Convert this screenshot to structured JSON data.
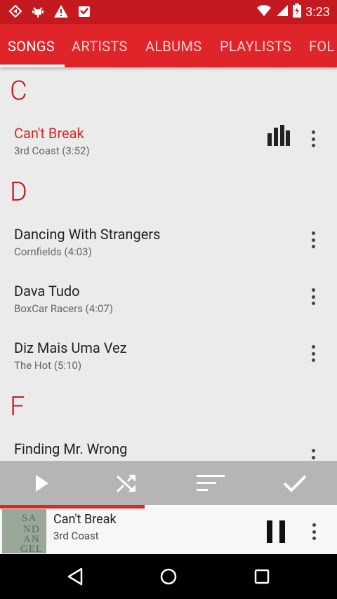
{
  "status_bar": {
    "icons": [
      "cast-icon",
      "android-debug-icon",
      "warning-icon",
      "inbox-icon"
    ],
    "right_icons": [
      "wifi-icon",
      "signal-icon",
      "battery-icon"
    ],
    "time": "3:23"
  },
  "tabs": [
    "SONGS",
    "ARTISTS",
    "ALBUMS",
    "PLAYLISTS",
    "FOL"
  ],
  "sections": [
    {
      "letter": "C",
      "songs": [
        {
          "title": "Can't Break",
          "sub": "3rd Coast (3:52)",
          "playing": true
        }
      ]
    },
    {
      "letter": "D",
      "songs": [
        {
          "title": "Dancing With Strangers",
          "sub": "Cornfields (4:03)"
        },
        {
          "title": "Dava Tudo",
          "sub": "BoxCar Racers (4:07)"
        },
        {
          "title": "Diz Mais Uma Vez",
          "sub": "The Hot (5:10)"
        }
      ]
    },
    {
      "letter": "F",
      "songs": [
        {
          "title": "Finding Mr. Wrong",
          "sub": ""
        }
      ]
    }
  ],
  "action_bar": [
    "play-icon",
    "shuffle-icon",
    "sort-icon",
    "check-icon"
  ],
  "now_playing": {
    "title": "Can't Break",
    "artist": "3rd Coast",
    "progress": 0.43,
    "art_text": [
      "SA",
      "ND",
      "AN",
      "GEL"
    ]
  },
  "nav_bar": [
    "back-icon",
    "home-icon",
    "recents-icon"
  ],
  "colors": {
    "primary": "#e0252a",
    "status": "#c41a1f",
    "accent": "#d42a2a"
  }
}
